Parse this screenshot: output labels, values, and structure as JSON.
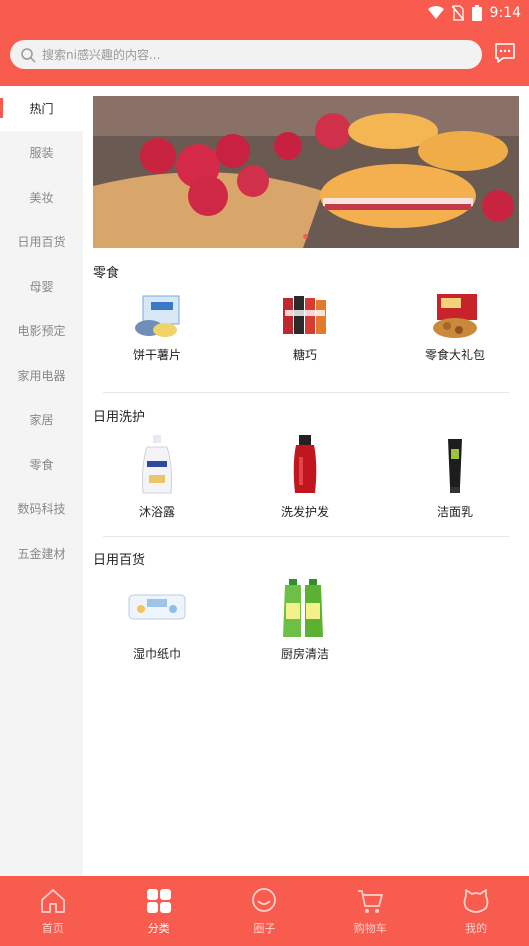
{
  "status_bar": {
    "time": "9:14",
    "icons": [
      "wifi-icon",
      "no-sim-icon",
      "battery-icon"
    ]
  },
  "search": {
    "placeholder": "搜索ni感兴趣的内容..."
  },
  "colors": {
    "brand": "#f85c4f",
    "sidebar_bg": "#f4f4f4",
    "tab_inactive": "#fbd0cb"
  },
  "sidebar": {
    "items": [
      {
        "label": "热门",
        "active": true
      },
      {
        "label": "服装"
      },
      {
        "label": "美妆"
      },
      {
        "label": "日用百货"
      },
      {
        "label": "母婴"
      },
      {
        "label": "电影预定"
      },
      {
        "label": "家用电器"
      },
      {
        "label": "家居"
      },
      {
        "label": "零食"
      },
      {
        "label": "数码科技"
      },
      {
        "label": "五金建材"
      }
    ]
  },
  "sections": [
    {
      "title": "零食",
      "products": [
        {
          "name": "饼干薯片"
        },
        {
          "name": "糖巧"
        },
        {
          "name": "零食大礼包"
        }
      ]
    },
    {
      "title": "日用洗护",
      "products": [
        {
          "name": "沐浴露"
        },
        {
          "name": "洗发护发"
        },
        {
          "name": "洁面乳"
        }
      ]
    },
    {
      "title": "日用百货",
      "products": [
        {
          "name": "湿巾纸巾"
        },
        {
          "name": "厨房清洁"
        }
      ]
    }
  ],
  "tabbar": {
    "tabs": [
      {
        "label": "首页",
        "icon": "home-icon"
      },
      {
        "label": "分类",
        "icon": "category-icon",
        "active": true
      },
      {
        "label": "圈子",
        "icon": "chat-circle-icon"
      },
      {
        "label": "购物车",
        "icon": "cart-icon"
      },
      {
        "label": "我的",
        "icon": "profile-icon"
      }
    ]
  }
}
